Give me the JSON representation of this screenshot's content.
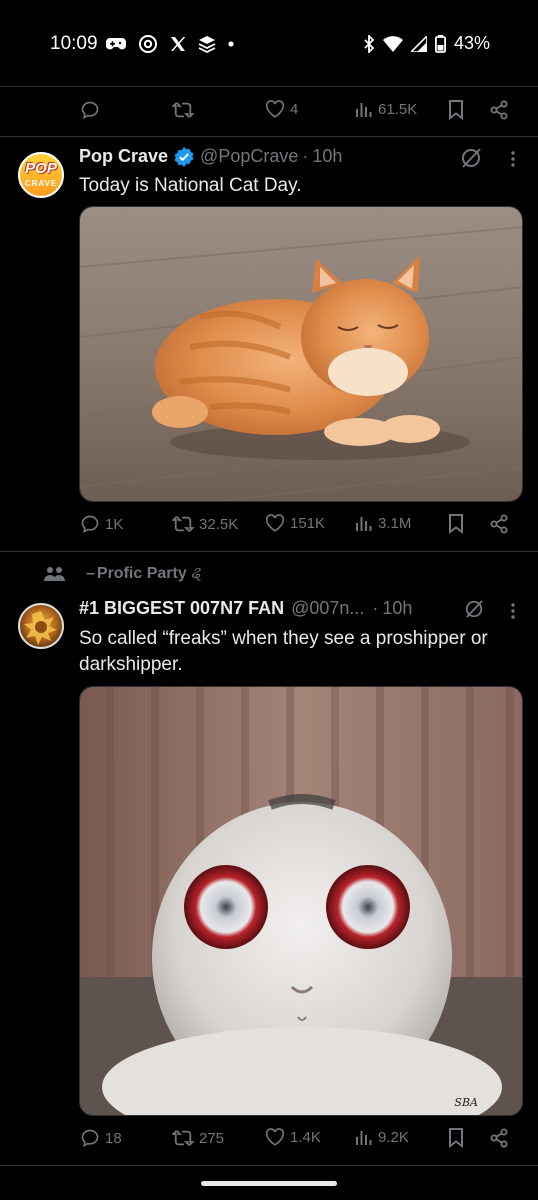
{
  "status_bar": {
    "time": "10:09",
    "battery": "43%",
    "left_icons": [
      "gamepad-icon",
      "threads-icon",
      "x-logo-icon",
      "app-icon",
      "dot-icon"
    ],
    "right_icons": [
      "bluetooth-icon",
      "wifi-icon",
      "signal-icon",
      "battery-icon"
    ]
  },
  "top_actions": {
    "likes": "4",
    "views": "61.5K"
  },
  "tweet1": {
    "name": "Pop Crave",
    "verified": true,
    "handle": "@PopCrave",
    "time": "10h",
    "text": "Today is National Cat Day.",
    "avatar_text_top": "POP",
    "avatar_text_bottom": "CRAVE",
    "media": "orange-tabby-cat-photo",
    "replies": "1K",
    "reposts": "32.5K",
    "likes": "151K",
    "views": "3.1M"
  },
  "tweet2": {
    "reposted_by": "Profic Party",
    "reposted_by_suffix": "ୡ",
    "name": "#1 BIGGEST 007N7 FAN",
    "handle": "@007n...",
    "time": "10h",
    "text": "So called “freaks” when they see a proshipper or darkshipper.",
    "media": "white-cat-red-eyes-photo",
    "media_signature": "SBA",
    "replies": "18",
    "reposts": "275",
    "likes": "1.4K",
    "views": "9.2K"
  },
  "colors": {
    "background": "#000000",
    "text": "#e7e9ea",
    "muted": "#71767b",
    "verified": "#1d9bf0"
  }
}
